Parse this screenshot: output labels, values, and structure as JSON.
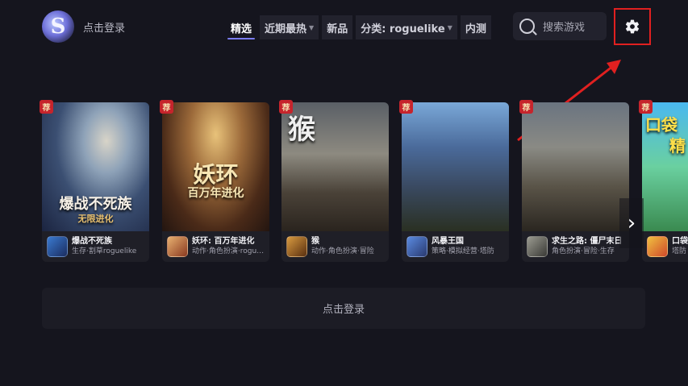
{
  "header": {
    "login_link": "点击登录",
    "nav": [
      {
        "label": "精选"
      },
      {
        "label": "近期最热"
      },
      {
        "label": "新品"
      },
      {
        "label": "分类: roguelike"
      },
      {
        "label": "内测"
      }
    ],
    "search_placeholder": "搜索游戏",
    "accent_color": "#7a7cf0",
    "highlight_color": "#e02020"
  },
  "cards": [
    {
      "name": "爆战不死族",
      "tags": "生存·割草roguelike",
      "art_title": "爆战不死族",
      "art_subtitle": "无限进化",
      "badge": "荐"
    },
    {
      "name": "妖环: 百万年进化",
      "tags": "动作·角色扮演·roguelike",
      "art_title": "妖环",
      "art_subtitle": "百万年进化",
      "badge": "荐"
    },
    {
      "name": "猴",
      "tags": "动作·角色扮演·冒险",
      "art_title": "猴",
      "badge": "荐"
    },
    {
      "name": "风暴王国",
      "tags": "策略·模拟经营·塔防",
      "badge": "荐"
    },
    {
      "name": "求生之路: 僵尸末日",
      "tags": "角色扮演·冒险·生存",
      "badge": "荐"
    },
    {
      "name": "口袋",
      "tags": "塔防",
      "art_title": "口袋",
      "art_subtitle": "精",
      "badge": "荐"
    }
  ],
  "next_arrow": "›",
  "login_bar": "点击登录"
}
